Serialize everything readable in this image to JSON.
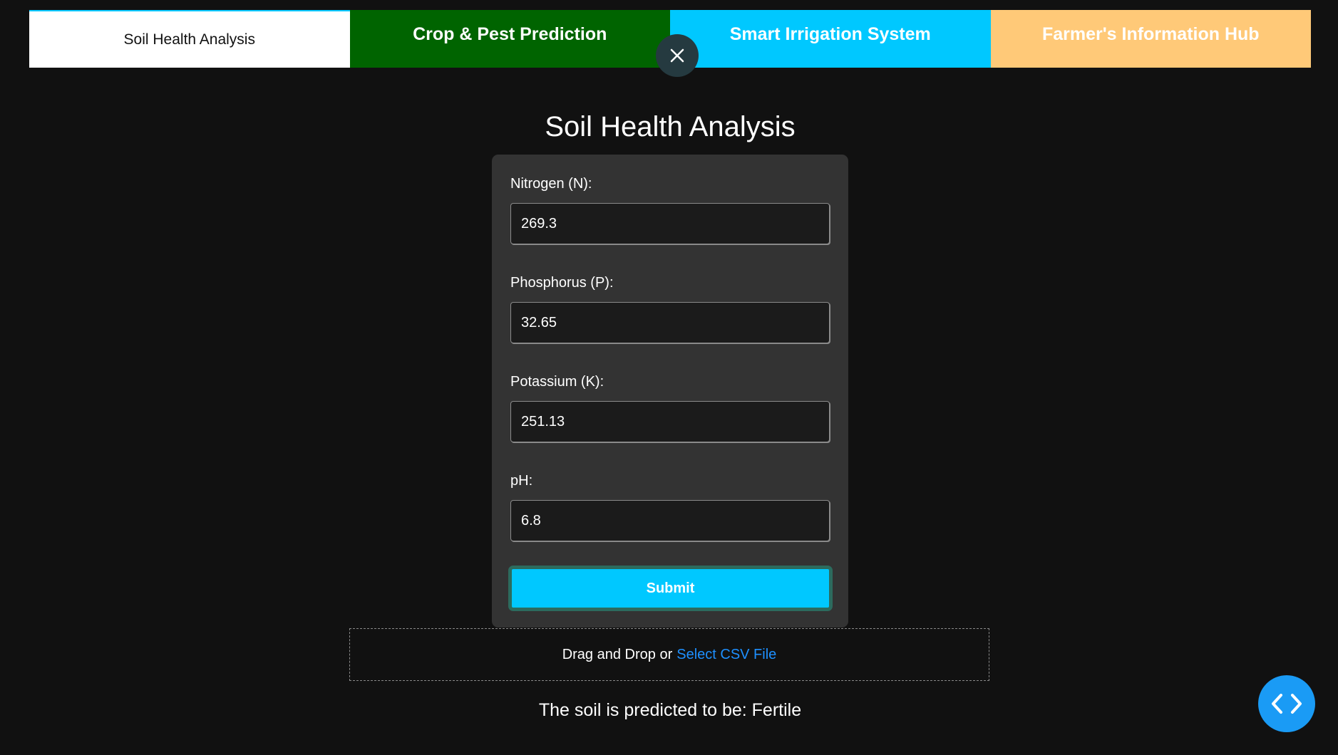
{
  "tabs": [
    {
      "label": "Soil Health Analysis"
    },
    {
      "label": "Crop & Pest Prediction"
    },
    {
      "label": "Smart Irrigation System"
    },
    {
      "label": "Farmer's Information Hub"
    }
  ],
  "close_icon": "close-icon",
  "page_title": "Soil Health Analysis",
  "form": {
    "fields": [
      {
        "label": "Nitrogen (N):",
        "value": "269.3"
      },
      {
        "label": "Phosphorus (P):",
        "value": "32.65"
      },
      {
        "label": "Potassium (K):",
        "value": "251.13"
      },
      {
        "label": "pH:",
        "value": "6.8"
      }
    ],
    "submit_label": "Submit"
  },
  "dropzone": {
    "text": "Drag and Drop or",
    "link": "Select CSV File"
  },
  "result": "The soil is predicted to be: Fertile",
  "code_icon": "code-icon",
  "colors": {
    "background": "#111111",
    "tab_active": "#ffffff",
    "tab_crop": "#006400",
    "tab_irrigation": "#00c8ff",
    "tab_info": "#ffc978",
    "submit": "#00c8ff",
    "link": "#1e90ff",
    "fab": "#1a9bf5"
  }
}
